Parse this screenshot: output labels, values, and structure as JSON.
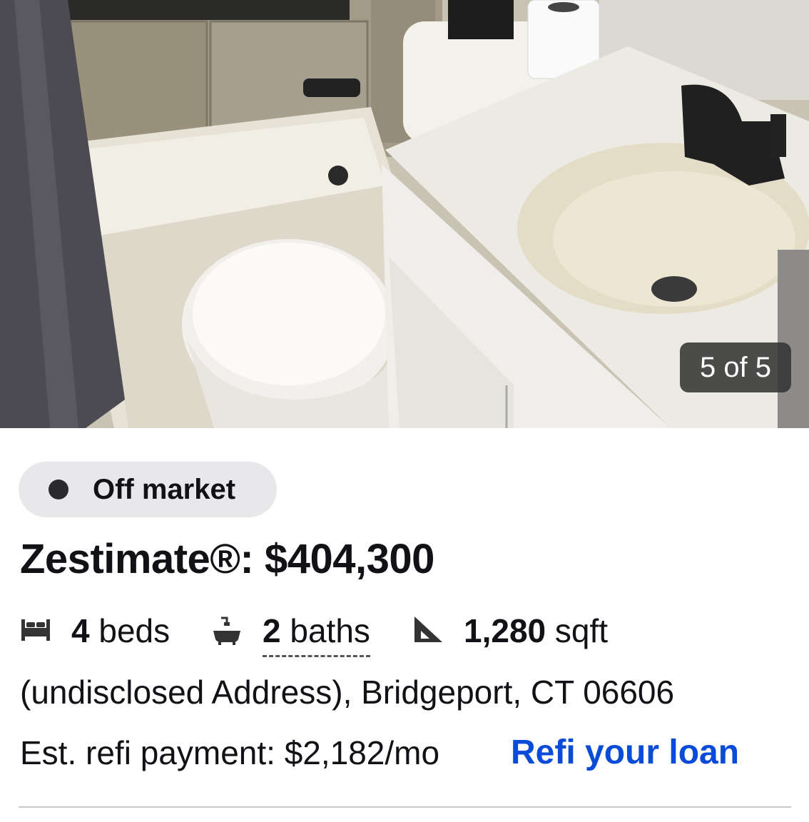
{
  "gallery": {
    "counter": "5 of 5",
    "photo_alt": "Bathroom with tub, toilet and vanity sink"
  },
  "status": {
    "label": "Off market",
    "dot_color": "#2a2a2e"
  },
  "zestimate": {
    "text": "Zestimate®: $404,300"
  },
  "facts": {
    "beds": {
      "value": "4",
      "unit": "beds",
      "icon": "bed-icon"
    },
    "baths": {
      "value": "2",
      "unit": "baths",
      "icon": "bathtub-icon"
    },
    "sqft": {
      "value": "1,280",
      "unit": "sqft",
      "icon": "ruler-triangle-icon"
    }
  },
  "address": "(undisclosed Address), Bridgeport, CT 06606",
  "refi": {
    "payment_text": "Est. refi payment: $2,182/mo",
    "link_label": "Refi your loan",
    "link_color": "#0a4bd8"
  }
}
